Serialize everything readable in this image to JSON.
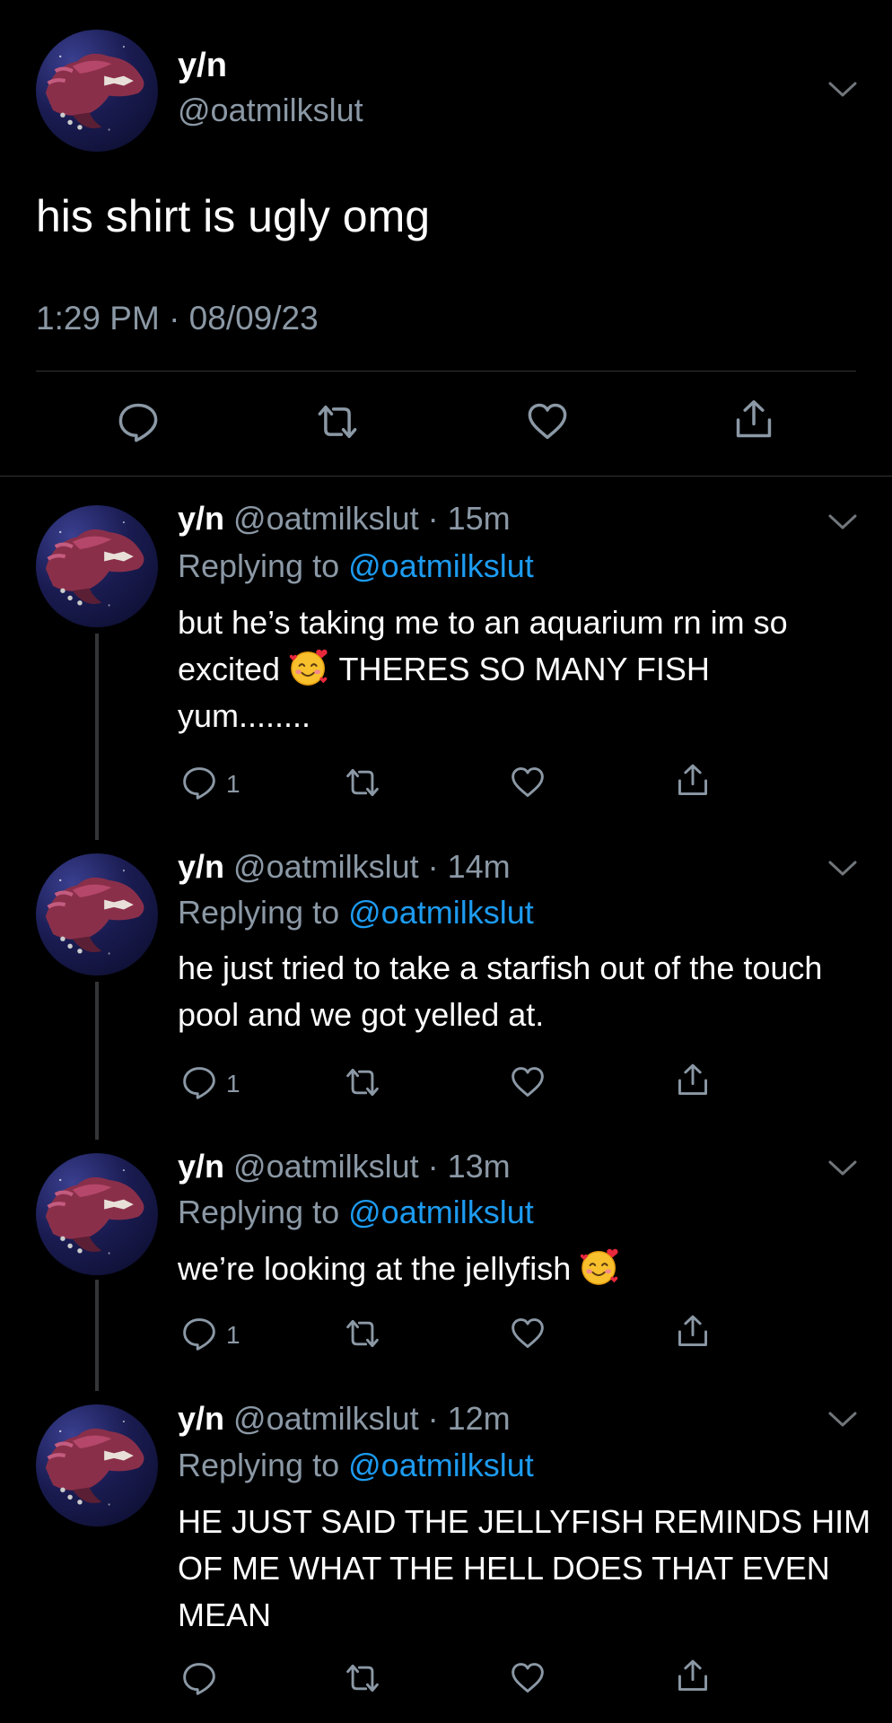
{
  "main_tweet": {
    "display_name": "y/n",
    "handle": "@oatmilkslut",
    "text": "his shirt is ugly omg",
    "timestamp": "1:29 PM · 08/09/23",
    "menu_icon": "chevron-down-icon",
    "action_icons": [
      "reply-icon",
      "retweet-icon",
      "like-icon",
      "share-icon"
    ]
  },
  "replies": [
    {
      "display_name": "y/n",
      "handle_time": "@oatmilkslut · 15m",
      "replying_label": "Replying to",
      "replying_handle": "@oatmilkslut",
      "text_parts": [
        "but he’s taking me to an aquarium rn im so excited",
        "THERES SO MANY FISH yum........"
      ],
      "emoji": "smiling-face-with-hearts",
      "reply_count": "1"
    },
    {
      "display_name": "y/n",
      "handle_time": "@oatmilkslut · 14m",
      "replying_label": "Replying to",
      "replying_handle": "@oatmilkslut",
      "text": "he just tried to take a starfish out of the touch pool and we got yelled at.",
      "reply_count": "1"
    },
    {
      "display_name": "y/n",
      "handle_time": "@oatmilkslut · 13m",
      "replying_label": "Replying to",
      "replying_handle": "@oatmilkslut",
      "text": "we’re looking at the jellyfish",
      "emoji": "smiling-face-with-hearts",
      "reply_count": "1"
    },
    {
      "display_name": "y/n",
      "handle_time": "@oatmilkslut · 12m",
      "replying_label": "Replying to",
      "replying_handle": "@oatmilkslut",
      "text": "HE JUST SAID THE JELLYFISH REMINDS HIM OF ME WHAT THE HELL DOES THAT EVEN MEAN"
    }
  ],
  "colors": {
    "background": "#000000",
    "primary_text": "#ffffff",
    "secondary_text": "#8b98a5",
    "link": "#1d9bf0",
    "divider": "#2f3336"
  }
}
